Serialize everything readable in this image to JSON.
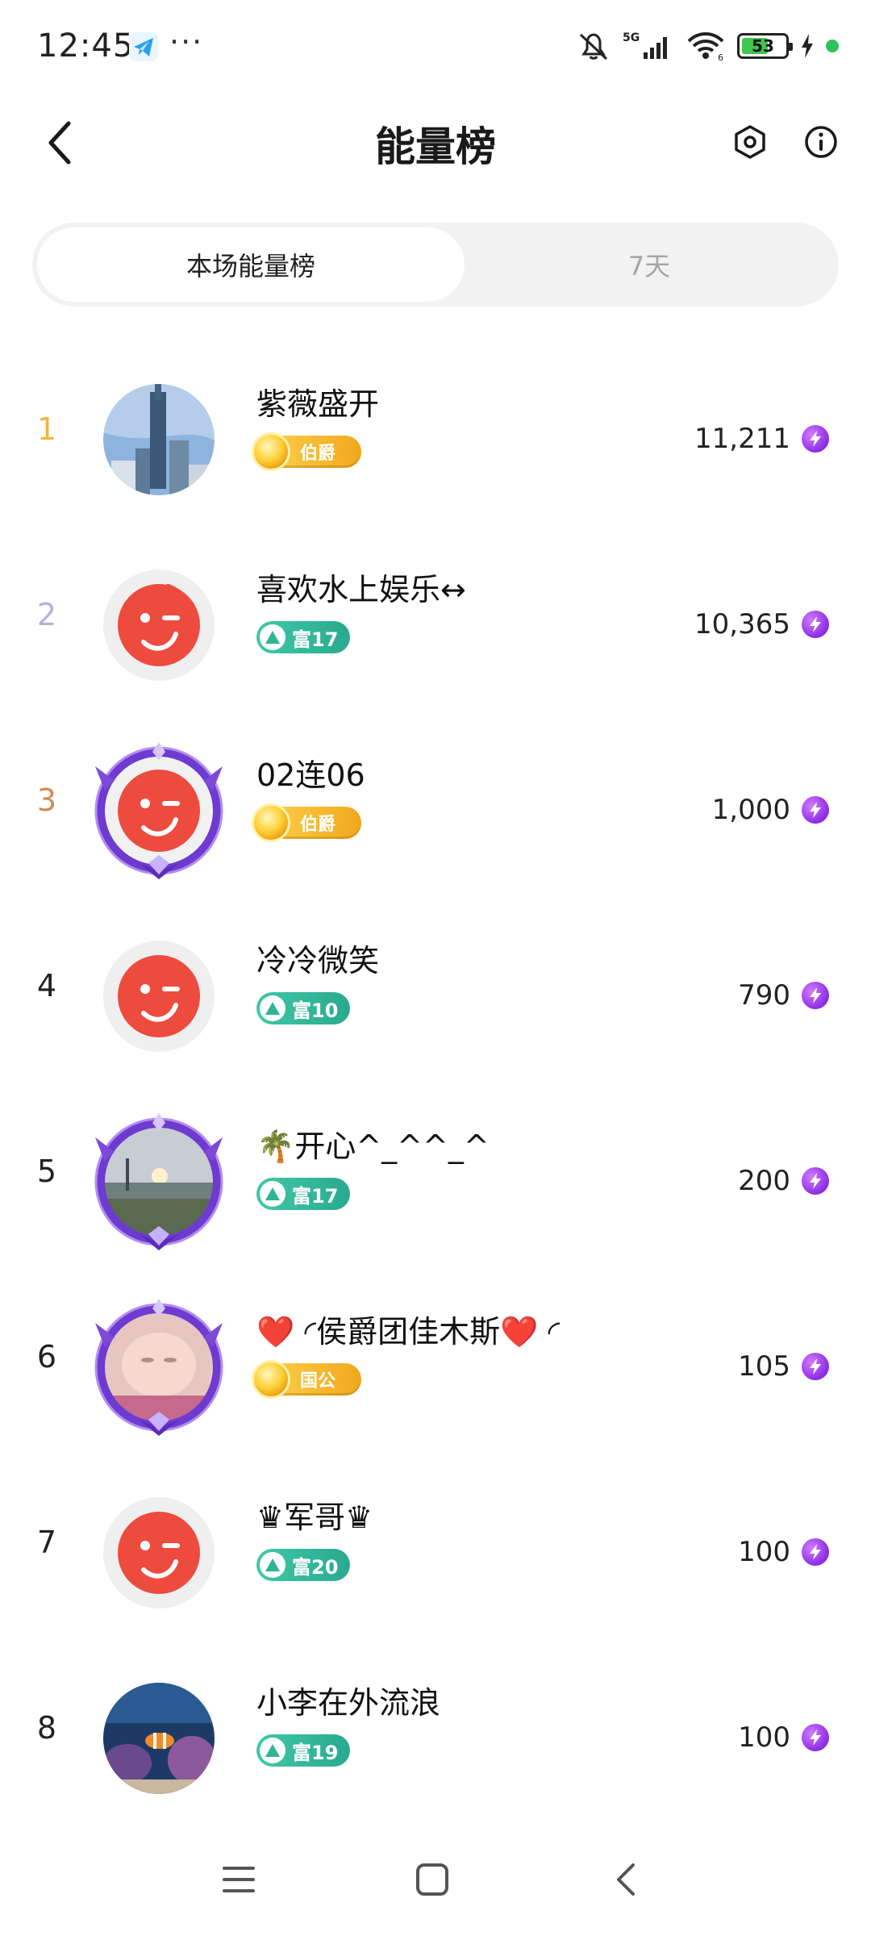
{
  "status_bar": {
    "time": "12:45",
    "more": "···",
    "battery": "53",
    "network": "5G"
  },
  "header": {
    "title": "能量榜"
  },
  "tabs": [
    {
      "label": "本场能量榜",
      "active": true
    },
    {
      "label": "7天",
      "active": false
    }
  ],
  "colors": {
    "face": "#ee4b3f",
    "rich_badge": "#2fb496",
    "noble_badge": "#f5b52a",
    "energy": "#9b34ea"
  },
  "ranking": [
    {
      "rank": "1",
      "name": "紫薇盛开",
      "badge": "伯爵",
      "badge_type": "noble",
      "score": "11,211",
      "avatar": "city-tower-photo"
    },
    {
      "rank": "2",
      "name": "喜欢水上娱乐↔",
      "badge": "富17",
      "badge_type": "rich",
      "score": "10,365",
      "avatar": "default-face"
    },
    {
      "rank": "3",
      "name": "02连06",
      "badge": "伯爵",
      "badge_type": "noble",
      "score": "1,000",
      "avatar": "default-face-framed"
    },
    {
      "rank": "4",
      "name": "冷冷微笑",
      "badge": "富10",
      "badge_type": "rich",
      "score": "790",
      "avatar": "default-face"
    },
    {
      "rank": "5",
      "name": "🌴开心^_^^_^",
      "badge": "富17",
      "badge_type": "rich",
      "score": "200",
      "avatar": "sunset-photo-framed"
    },
    {
      "rank": "6",
      "name": "❤️ ◜侯爵团佳木斯❤️ ◜",
      "badge": "国公",
      "badge_type": "noble",
      "score": "105",
      "avatar": "baby-photo-framed"
    },
    {
      "rank": "7",
      "name": "♛军哥♛",
      "badge": "富20",
      "badge_type": "rich",
      "score": "100",
      "avatar": "default-face"
    },
    {
      "rank": "8",
      "name": "小李在外流浪",
      "badge": "富19",
      "badge_type": "rich",
      "score": "100",
      "avatar": "aquarium-photo"
    }
  ]
}
